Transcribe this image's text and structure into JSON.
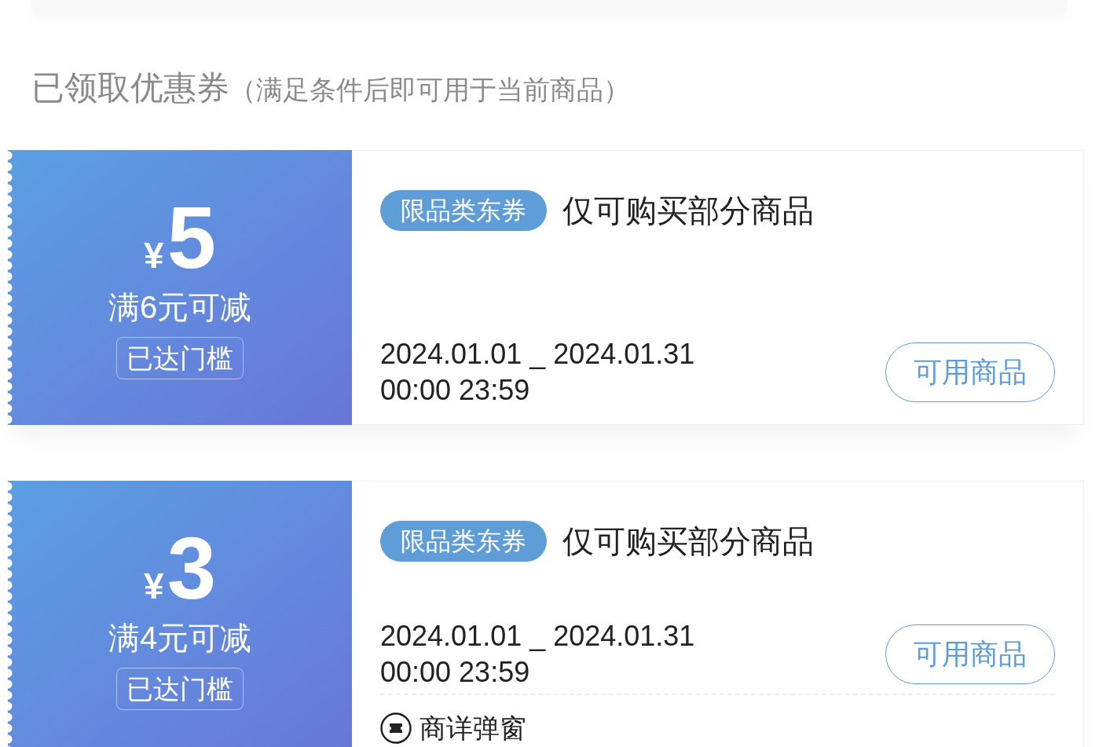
{
  "section": {
    "title": "已领取优惠券",
    "subtitle": "（满足条件后即可用于当前商品）"
  },
  "coupons": [
    {
      "currency": "¥",
      "amount": "5",
      "condition": "满6元可减",
      "threshold_badge": "已达门槛",
      "tag": "限品类东券",
      "title": "仅可购买部分商品",
      "date_range": "2024.01.01 _ 2024.01.31",
      "time_range": "00:00 23:59",
      "action": "可用商品"
    },
    {
      "currency": "¥",
      "amount": "3",
      "condition": "满4元可减",
      "threshold_badge": "已达门槛",
      "tag": "限品类东券",
      "title": "仅可购买部分商品",
      "date_range": "2024.01.01 _ 2024.01.31",
      "time_range": "00:00 23:59",
      "action": "可用商品",
      "footer": {
        "label": "商详弹窗"
      }
    }
  ]
}
